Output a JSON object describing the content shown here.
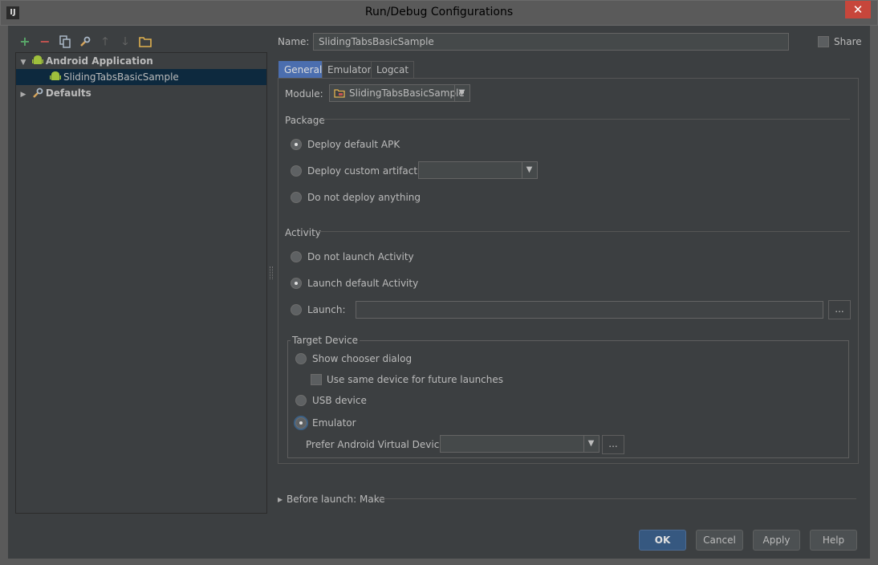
{
  "window": {
    "title": "Run/Debug Configurations",
    "app_icon": "IJ",
    "close_glyph": "✕"
  },
  "toolbar": {
    "icons": [
      "plus-icon",
      "minus-icon",
      "copy-icon",
      "wrench-icon",
      "arrow-up-icon",
      "arrow-down-icon",
      "folder-icon"
    ]
  },
  "tree": {
    "group_label": "Android Application",
    "item_label": "SlidingTabsBasicSample",
    "defaults_label": "Defaults"
  },
  "name_field": {
    "label": "Name:",
    "value": "SlidingTabsBasicSample",
    "share_label": "Share"
  },
  "tabs": [
    "General",
    "Emulator",
    "Logcat"
  ],
  "module": {
    "label": "Module:",
    "value": "SlidingTabsBasicSample"
  },
  "package": {
    "title": "Package",
    "options": [
      "Deploy default APK",
      "Deploy custom artifact:",
      "Do not deploy anything"
    ],
    "selected": 0
  },
  "activity": {
    "title": "Activity",
    "options": [
      "Do not launch Activity",
      "Launch default Activity",
      "Launch:"
    ],
    "selected": 1
  },
  "target_device": {
    "title": "Target Device",
    "show_chooser": "Show chooser dialog",
    "same_device": "Use same device for future launches",
    "usb": "USB device",
    "emulator": "Emulator",
    "prefer_avd": "Prefer Android Virtual Device:"
  },
  "before_launch": {
    "label": "Before launch: Make"
  },
  "buttons": {
    "ok": "OK",
    "cancel": "Cancel",
    "apply": "Apply",
    "help": "Help"
  },
  "ellipsis": "...",
  "colors": {
    "background": "#3c3f41",
    "selection": "#0d293e",
    "tab_active": "#4b6eaf",
    "default_button": "#365880",
    "android_green": "#9fc03c"
  }
}
